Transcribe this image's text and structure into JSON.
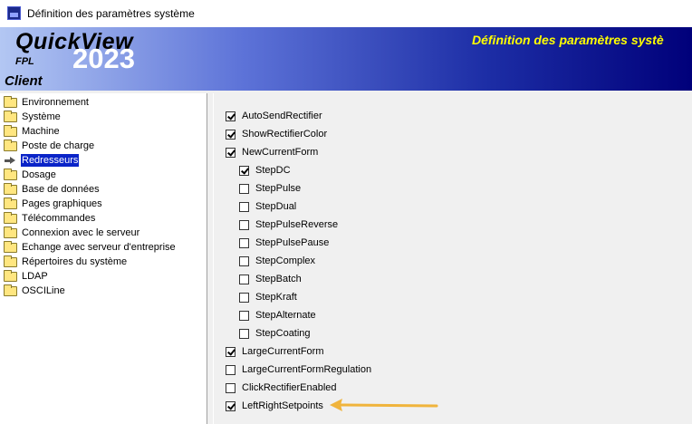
{
  "window": {
    "title": "Définition des paramètres système"
  },
  "banner": {
    "brand": "QuickView",
    "brand_sub": "FPL",
    "year": "2023",
    "client": "Client",
    "title": "Définition des paramètres systè"
  },
  "tree": {
    "items": [
      {
        "label": "Environnement",
        "icon": "folder-icon"
      },
      {
        "label": "Système",
        "icon": "folder-icon"
      },
      {
        "label": "Machine",
        "icon": "folder-icon"
      },
      {
        "label": "Poste de charge",
        "icon": "folder-icon"
      },
      {
        "label": "Redresseurs",
        "icon": "arrow-right-icon",
        "selected": true
      },
      {
        "label": "Dosage",
        "icon": "folder-icon"
      },
      {
        "label": "Base de données",
        "icon": "folder-icon"
      },
      {
        "label": "Pages graphiques",
        "icon": "folder-icon"
      },
      {
        "label": "Télécommandes",
        "icon": "folder-icon"
      },
      {
        "label": "Connexion avec le serveur",
        "icon": "folder-icon"
      },
      {
        "label": "Echange avec serveur d'entreprise",
        "icon": "folder-icon"
      },
      {
        "label": "Répertoires du système",
        "icon": "folder-icon"
      },
      {
        "label": "LDAP",
        "icon": "folder-icon"
      },
      {
        "label": "OSCILine",
        "icon": "folder-icon"
      }
    ]
  },
  "options": [
    {
      "label": "AutoSendRectifier",
      "checked": true,
      "indent": 0
    },
    {
      "label": "ShowRectifierColor",
      "checked": true,
      "indent": 0
    },
    {
      "label": "NewCurrentForm",
      "checked": true,
      "indent": 0
    },
    {
      "label": "StepDC",
      "checked": true,
      "indent": 1
    },
    {
      "label": "StepPulse",
      "checked": false,
      "indent": 1
    },
    {
      "label": "StepDual",
      "checked": false,
      "indent": 1
    },
    {
      "label": "StepPulseReverse",
      "checked": false,
      "indent": 1
    },
    {
      "label": "StepPulsePause",
      "checked": false,
      "indent": 1
    },
    {
      "label": "StepComplex",
      "checked": false,
      "indent": 1
    },
    {
      "label": "StepBatch",
      "checked": false,
      "indent": 1
    },
    {
      "label": "StepKraft",
      "checked": false,
      "indent": 1
    },
    {
      "label": "StepAlternate",
      "checked": false,
      "indent": 1
    },
    {
      "label": "StepCoating",
      "checked": false,
      "indent": 1
    },
    {
      "label": "LargeCurrentForm",
      "checked": true,
      "indent": 0
    },
    {
      "label": "LargeCurrentFormRegulation",
      "checked": false,
      "indent": 0
    },
    {
      "label": "ClickRectifierEnabled",
      "checked": false,
      "indent": 0
    },
    {
      "label": "LeftRightSetpoints",
      "checked": true,
      "indent": 0
    }
  ],
  "colors": {
    "selection": "#0a24c8",
    "banner_title": "#ffff00",
    "annotation_arrow": "#f0b43c"
  }
}
